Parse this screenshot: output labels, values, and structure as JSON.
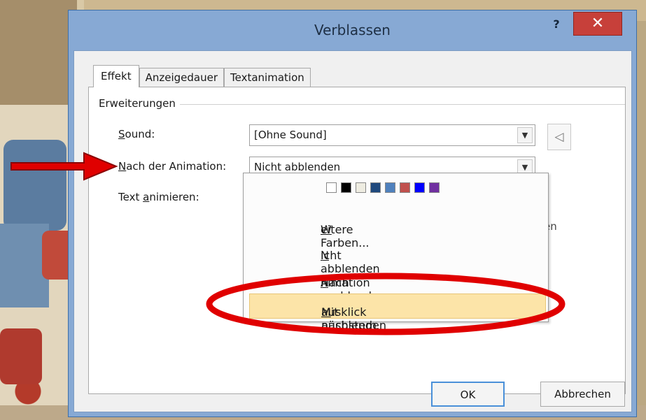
{
  "dialog": {
    "title": "Verblassen",
    "help_label": "?",
    "close_label": "✕"
  },
  "tabs": [
    {
      "label": "Effekt",
      "active": true
    },
    {
      "label": "Anzeigedauer",
      "active": false
    },
    {
      "label": "Textanimation",
      "active": false
    }
  ],
  "group": {
    "label": "Erweiterungen"
  },
  "fields": {
    "sound": {
      "label_pre": "",
      "label_mnemonic": "S",
      "label_post": "ound:",
      "value": "[Ohne Sound]"
    },
    "after_animation": {
      "label_pre": "",
      "label_mnemonic": "N",
      "label_post": "ach der Animation:",
      "value": "Nicht abblenden"
    },
    "animate_text": {
      "label_pre": "Text ",
      "label_mnemonic": "a",
      "label_post": "nimieren:"
    }
  },
  "partial_text": "en",
  "dropdown": {
    "swatches": [
      "#ffffff",
      "#000000",
      "#eeece1",
      "#1f497d",
      "#4f81bd",
      "#c0504d",
      "#0000ff",
      "#7030a0"
    ],
    "items": [
      {
        "pre": "",
        "mnemonic": "W",
        "post": "eitere Farben..."
      },
      {
        "pre": "",
        "mnemonic": "N",
        "post": "icht abblenden"
      },
      {
        "pre": "Nach ",
        "mnemonic": "A",
        "post": "nimation ausblenden"
      },
      {
        "pre": "Mit nächstem ",
        "mnemonic": "M",
        "post": "ausklick ausblenden",
        "highlighted": true
      }
    ]
  },
  "buttons": {
    "ok": "OK",
    "cancel": "Abbrechen"
  },
  "icons": {
    "dropdown_arrow": "chevron-down-icon",
    "sound": "speaker-icon"
  },
  "colors": {
    "title_bar": "#87a9d4",
    "close_button": "#c7403a",
    "highlight": "#fce4a8",
    "annotation_red": "#e00000"
  }
}
